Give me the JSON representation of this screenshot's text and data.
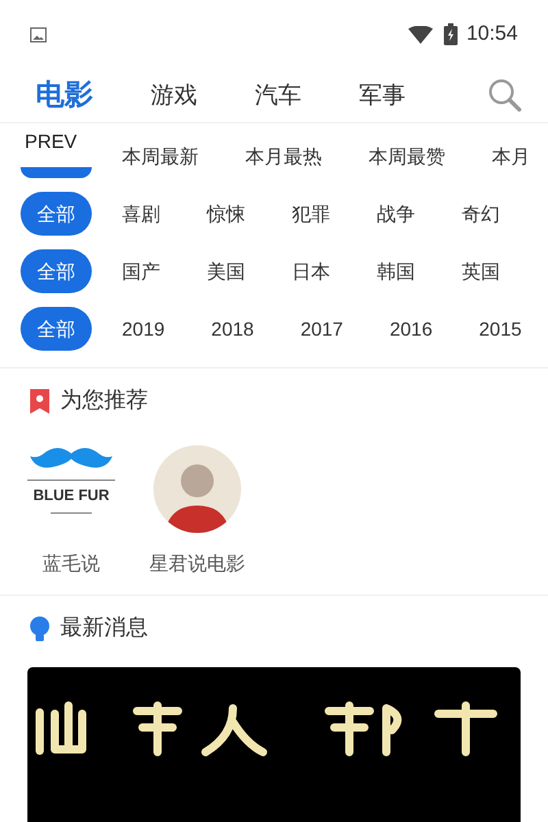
{
  "status_bar": {
    "time": "10:54"
  },
  "tabs": [
    {
      "label": "电影",
      "selected": true
    },
    {
      "label": "游戏",
      "selected": false
    },
    {
      "label": "汽车",
      "selected": false
    },
    {
      "label": "军事",
      "selected": false
    }
  ],
  "filter_rows": [
    {
      "chips": [
        {
          "selected": true
        },
        {
          "label": "本周最新",
          "selected": false
        },
        {
          "label": "本月最热",
          "selected": false
        },
        {
          "label": "本周最赞",
          "selected": false
        },
        {
          "label": "本月",
          "selected": false
        }
      ],
      "overlay": "PREV"
    },
    {
      "chips": [
        {
          "label": "全部",
          "selected": true
        },
        {
          "label": "喜剧",
          "selected": false
        },
        {
          "label": "惊悚",
          "selected": false
        },
        {
          "label": "犯罪",
          "selected": false
        },
        {
          "label": "战争",
          "selected": false
        },
        {
          "label": "奇幻",
          "selected": false
        }
      ]
    },
    {
      "chips": [
        {
          "label": "全部",
          "selected": true
        },
        {
          "label": "国产",
          "selected": false
        },
        {
          "label": "美国",
          "selected": false
        },
        {
          "label": "日本",
          "selected": false
        },
        {
          "label": "韩国",
          "selected": false
        },
        {
          "label": "英国",
          "selected": false
        }
      ]
    },
    {
      "chips": [
        {
          "label": "全部",
          "selected": true
        },
        {
          "label": "2019",
          "selected": false
        },
        {
          "label": "2018",
          "selected": false
        },
        {
          "label": "2017",
          "selected": false
        },
        {
          "label": "2016",
          "selected": false
        },
        {
          "label": "2015",
          "selected": false
        }
      ]
    }
  ],
  "recommend": {
    "title": "为您推荐",
    "items": [
      {
        "kind": "logo",
        "logo_text": "BLUE FUR",
        "name": "蓝毛说"
      },
      {
        "kind": "avatar",
        "name": "星君说电影"
      }
    ]
  },
  "news": {
    "title": "最新消息"
  }
}
